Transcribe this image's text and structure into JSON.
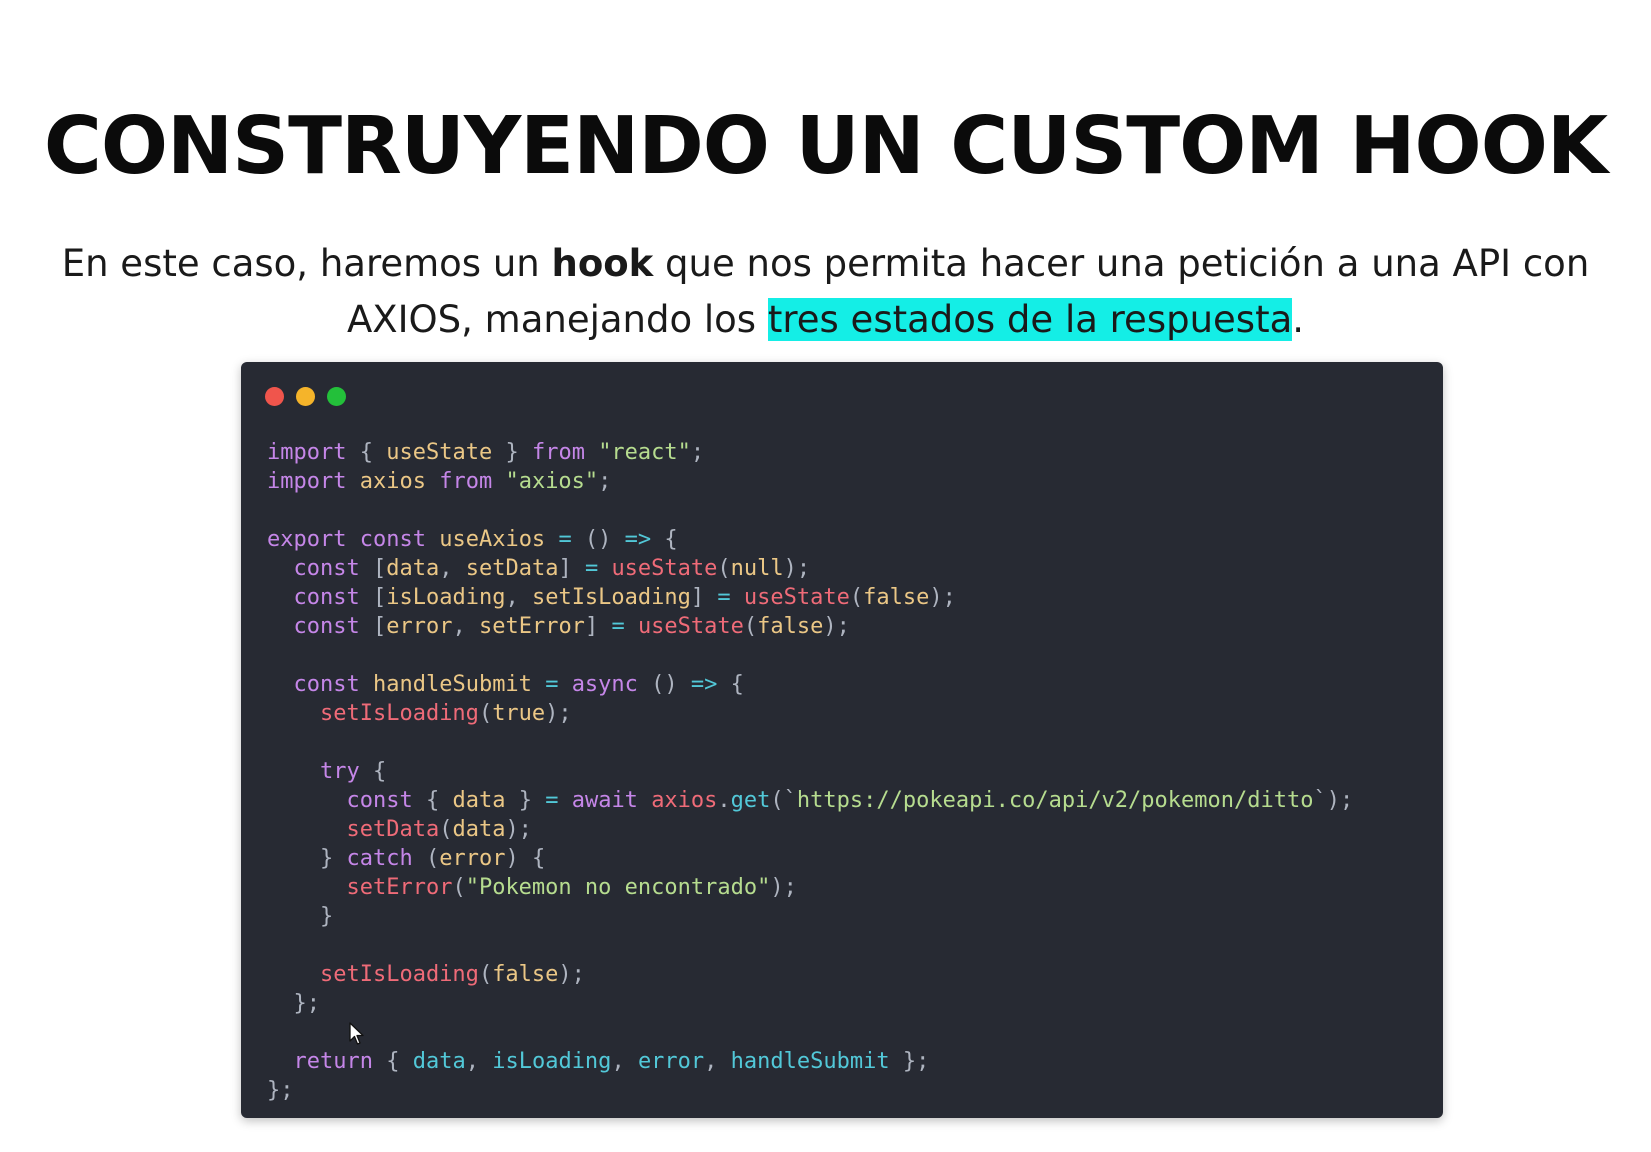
{
  "slide": {
    "title": "CONSTRUYENDO UN CUSTOM HOOK",
    "subtitle": {
      "line1_before": "En este caso, haremos un ",
      "line1_bold": "hook",
      "line1_after": " que nos permita hacer una petición a una API con",
      "line2_before": "AXIOS, manejando los ",
      "line2_highlight": "tres estados de la respuesta",
      "line2_after": "."
    },
    "highlight_color": "#14eee6"
  },
  "code_window": {
    "background": "#272a33",
    "controls": [
      "close-dot",
      "minimize-dot",
      "maximize-dot"
    ],
    "lines": [
      [
        [
          "kw",
          "import"
        ],
        [
          "pun",
          " { "
        ],
        [
          "var",
          "useState"
        ],
        [
          "pun",
          " } "
        ],
        [
          "kw",
          "from"
        ],
        [
          "pun",
          " "
        ],
        [
          "str",
          "\"react\""
        ],
        [
          "pun",
          ";"
        ]
      ],
      [
        [
          "kw",
          "import"
        ],
        [
          "pun",
          " "
        ],
        [
          "var",
          "axios"
        ],
        [
          "pun",
          " "
        ],
        [
          "kw",
          "from"
        ],
        [
          "pun",
          " "
        ],
        [
          "str",
          "\"axios\""
        ],
        [
          "pun",
          ";"
        ]
      ],
      [],
      [
        [
          "kw",
          "export"
        ],
        [
          "pun",
          " "
        ],
        [
          "kw",
          "const"
        ],
        [
          "pun",
          " "
        ],
        [
          "var",
          "useAxios"
        ],
        [
          "pun",
          " "
        ],
        [
          "op",
          "="
        ],
        [
          "pun",
          " () "
        ],
        [
          "op",
          "=>"
        ],
        [
          "pun",
          " {"
        ]
      ],
      [
        [
          "pun",
          "  "
        ],
        [
          "kw",
          "const"
        ],
        [
          "pun",
          " ["
        ],
        [
          "var",
          "data"
        ],
        [
          "pun",
          ", "
        ],
        [
          "var",
          "setData"
        ],
        [
          "pun",
          "] "
        ],
        [
          "op",
          "="
        ],
        [
          "pun",
          " "
        ],
        [
          "fn",
          "useState"
        ],
        [
          "pun",
          "("
        ],
        [
          "lit",
          "null"
        ],
        [
          "pun",
          ");"
        ]
      ],
      [
        [
          "pun",
          "  "
        ],
        [
          "kw",
          "const"
        ],
        [
          "pun",
          " ["
        ],
        [
          "var",
          "isLoading"
        ],
        [
          "pun",
          ", "
        ],
        [
          "var",
          "setIsLoading"
        ],
        [
          "pun",
          "] "
        ],
        [
          "op",
          "="
        ],
        [
          "pun",
          " "
        ],
        [
          "fn",
          "useState"
        ],
        [
          "pun",
          "("
        ],
        [
          "lit",
          "false"
        ],
        [
          "pun",
          ");"
        ]
      ],
      [
        [
          "pun",
          "  "
        ],
        [
          "kw",
          "const"
        ],
        [
          "pun",
          " ["
        ],
        [
          "var",
          "error"
        ],
        [
          "pun",
          ", "
        ],
        [
          "var",
          "setError"
        ],
        [
          "pun",
          "] "
        ],
        [
          "op",
          "="
        ],
        [
          "pun",
          " "
        ],
        [
          "fn",
          "useState"
        ],
        [
          "pun",
          "("
        ],
        [
          "lit",
          "false"
        ],
        [
          "pun",
          ");"
        ]
      ],
      [],
      [
        [
          "pun",
          "  "
        ],
        [
          "kw",
          "const"
        ],
        [
          "pun",
          " "
        ],
        [
          "var",
          "handleSubmit"
        ],
        [
          "pun",
          " "
        ],
        [
          "op",
          "="
        ],
        [
          "pun",
          " "
        ],
        [
          "kw",
          "async"
        ],
        [
          "pun",
          " () "
        ],
        [
          "op",
          "=>"
        ],
        [
          "pun",
          " {"
        ]
      ],
      [
        [
          "pun",
          "    "
        ],
        [
          "fn",
          "setIsLoading"
        ],
        [
          "pun",
          "("
        ],
        [
          "lit",
          "true"
        ],
        [
          "pun",
          ");"
        ]
      ],
      [],
      [
        [
          "pun",
          "    "
        ],
        [
          "kw",
          "try"
        ],
        [
          "pun",
          " {"
        ]
      ],
      [
        [
          "pun",
          "      "
        ],
        [
          "kw",
          "const"
        ],
        [
          "pun",
          " { "
        ],
        [
          "var",
          "data"
        ],
        [
          "pun",
          " } "
        ],
        [
          "op",
          "="
        ],
        [
          "pun",
          " "
        ],
        [
          "kw",
          "await"
        ],
        [
          "pun",
          " "
        ],
        [
          "fn",
          "axios"
        ],
        [
          "pun",
          "."
        ],
        [
          "prop",
          "get"
        ],
        [
          "pun",
          "(`"
        ],
        [
          "str",
          "https://pokeapi.co/api/v2/pokemon/ditto"
        ],
        [
          "pun",
          "`);"
        ]
      ],
      [
        [
          "pun",
          "      "
        ],
        [
          "fn",
          "setData"
        ],
        [
          "pun",
          "("
        ],
        [
          "var",
          "data"
        ],
        [
          "pun",
          ");"
        ]
      ],
      [
        [
          "pun",
          "    } "
        ],
        [
          "kw",
          "catch"
        ],
        [
          "pun",
          " ("
        ],
        [
          "var",
          "error"
        ],
        [
          "pun",
          ") {"
        ]
      ],
      [
        [
          "pun",
          "      "
        ],
        [
          "fn",
          "setError"
        ],
        [
          "pun",
          "("
        ],
        [
          "str",
          "\"Pokemon no encontrado\""
        ],
        [
          "pun",
          ");"
        ]
      ],
      [
        [
          "pun",
          "    }"
        ]
      ],
      [],
      [
        [
          "pun",
          "    "
        ],
        [
          "fn",
          "setIsLoading"
        ],
        [
          "pun",
          "("
        ],
        [
          "lit",
          "false"
        ],
        [
          "pun",
          ");"
        ]
      ],
      [
        [
          "pun",
          "  };"
        ]
      ],
      [],
      [
        [
          "pun",
          "  "
        ],
        [
          "kw",
          "return"
        ],
        [
          "pun",
          " { "
        ],
        [
          "id",
          "data"
        ],
        [
          "pun",
          ", "
        ],
        [
          "id",
          "isLoading"
        ],
        [
          "pun",
          ", "
        ],
        [
          "id",
          "error"
        ],
        [
          "pun",
          ", "
        ],
        [
          "id",
          "handleSubmit"
        ],
        [
          "pun",
          " };"
        ]
      ],
      [
        [
          "pun",
          "};"
        ]
      ]
    ]
  }
}
